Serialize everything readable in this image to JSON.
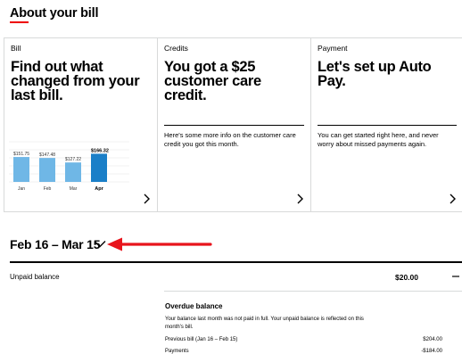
{
  "page": {
    "title": "About your bill",
    "accent_color": "#ee0000"
  },
  "cards": [
    {
      "label": "Bill",
      "headline": "Find out what changed from your last bill.",
      "chart_data": {
        "type": "bar",
        "categories": [
          "Jan",
          "Feb",
          "Mar",
          "Apr"
        ],
        "values": [
          151.75,
          147.48,
          127.22,
          166.32
        ],
        "value_labels": [
          "$151.75",
          "$147.48",
          "$127.22",
          "$166.32"
        ],
        "highlight_index": 3,
        "colors": {
          "bar": "#6fb7e6",
          "highlight": "#1a7fc8"
        }
      }
    },
    {
      "label": "Credits",
      "headline": "You got a $25 customer care credit.",
      "body": "Here's some more info on the customer care credit you got this month."
    },
    {
      "label": "Payment",
      "headline": "Let's set up Auto Pay.",
      "body": "You can get started right here, and never worry about missed payments again."
    }
  ],
  "period": {
    "label": "Feb 16 – Mar 15"
  },
  "annotation": {
    "arrow_color": "#e8141c"
  },
  "unpaid": {
    "label": "Unpaid balance",
    "amount": "$20.00"
  },
  "overdue": {
    "title": "Overdue balance",
    "description": "Your balance last month was not paid in full. Your unpaid balance is reflected on this month's bill.",
    "rows": [
      {
        "label": "Previous bill (Jan 16 – Feb 15)",
        "value": "$204.00"
      },
      {
        "label": "Payments",
        "value": "-$184.00"
      }
    ]
  }
}
